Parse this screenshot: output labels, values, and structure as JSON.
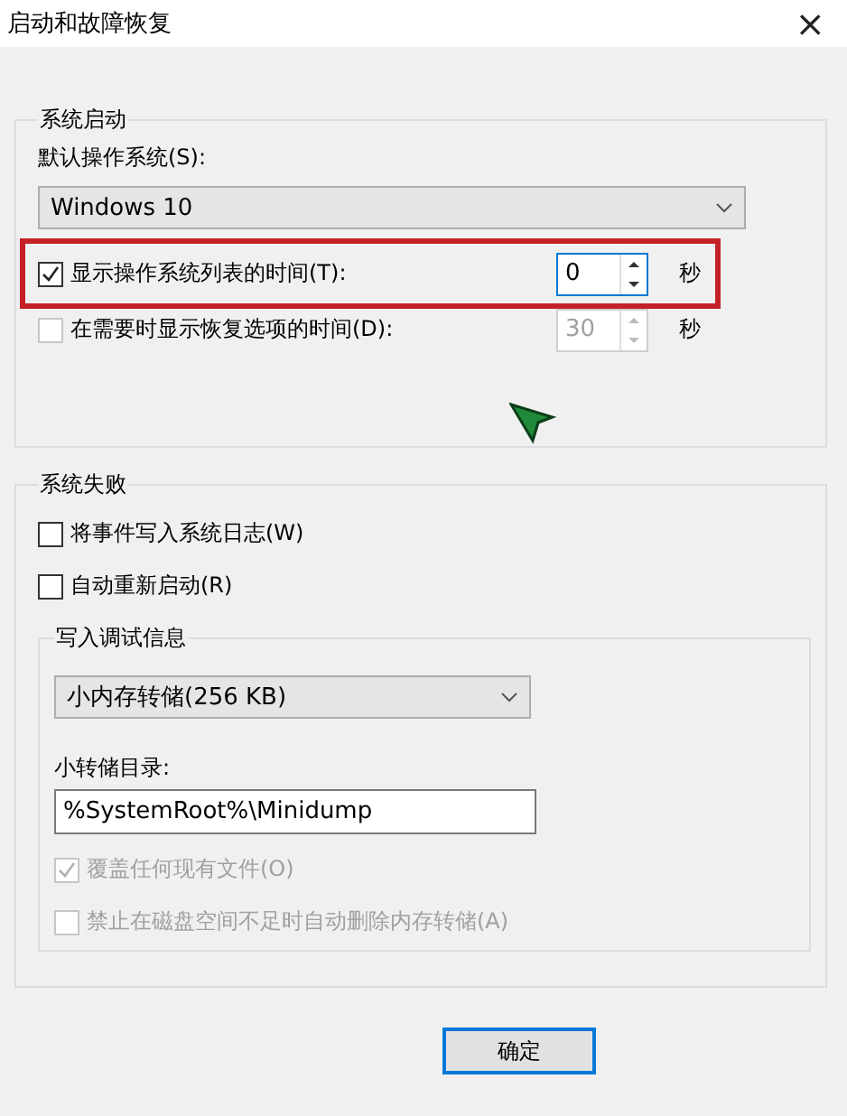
{
  "window": {
    "title": "启动和故障恢复",
    "close": "×"
  },
  "startup": {
    "title": "系统启动",
    "default_os_label": "默认操作系统(S):",
    "default_os": "Windows 10",
    "rows": [
      {
        "label": "显示操作系统列表的时间(T):",
        "checked": true,
        "value": "0",
        "unit": "秒",
        "disabled": false,
        "highlighted": true
      },
      {
        "label": "在需要时显示恢复选项的时间(D):",
        "checked": false,
        "value": "30",
        "unit": "秒",
        "disabled": true,
        "highlighted": false
      }
    ]
  },
  "failure": {
    "title": "系统失败",
    "options": [
      {
        "label": "将事件写入系统日志(W)",
        "checked": false,
        "disabled": false
      },
      {
        "label": "自动重新启动(R)",
        "checked": false,
        "disabled": false
      }
    ],
    "debug": {
      "title": "写入调试信息",
      "dump_type": "小内存转储(256 KB)",
      "dir_label": "小转储目录:",
      "dir_value": "%SystemRoot%\\Minidump",
      "options": [
        {
          "label": "覆盖任何现有文件(O)",
          "checked": true,
          "disabled": true
        },
        {
          "label": "禁止在磁盘空间不足时自动删除内存转储(A)",
          "checked": false,
          "disabled": true
        }
      ]
    }
  },
  "buttons": [
    {
      "label": "确定",
      "default": true
    }
  ]
}
